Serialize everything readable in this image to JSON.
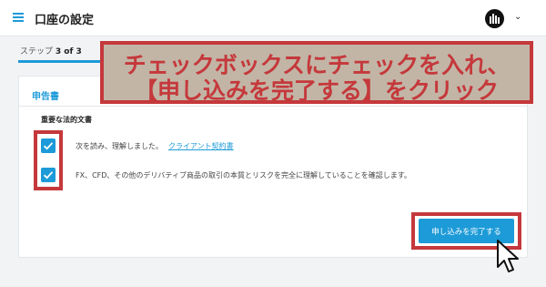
{
  "header": {
    "title": "口座の設定",
    "menu_icon": "hamburger-menu-icon",
    "avatar_icon": "account-avatar-icon",
    "dropdown_icon": "chevron-down-icon"
  },
  "steps": {
    "label": "ステップ",
    "current": "3 of 3",
    "progress": 1.0
  },
  "form": {
    "title": "申告書",
    "legal_heading": "重要な法的文書",
    "checkboxes": [
      {
        "text": "次を読み、理解しました。",
        "link": "クライアント契約書",
        "checked": true
      },
      {
        "text": "FX、CFD、その他のデリバティブ商品の取引の本質とリスクを完全に理解していることを確認します。",
        "checked": true
      }
    ],
    "submit_label": "申し込みを完了する"
  },
  "annotation": {
    "line1": "チェックボックスにチェックを入れ、",
    "line2": "【申し込みを完了する】をクリック"
  },
  "colors": {
    "accent": "#1d9bd8",
    "highlight": "#c5383b",
    "callout_bg": "#c2b5a6"
  }
}
